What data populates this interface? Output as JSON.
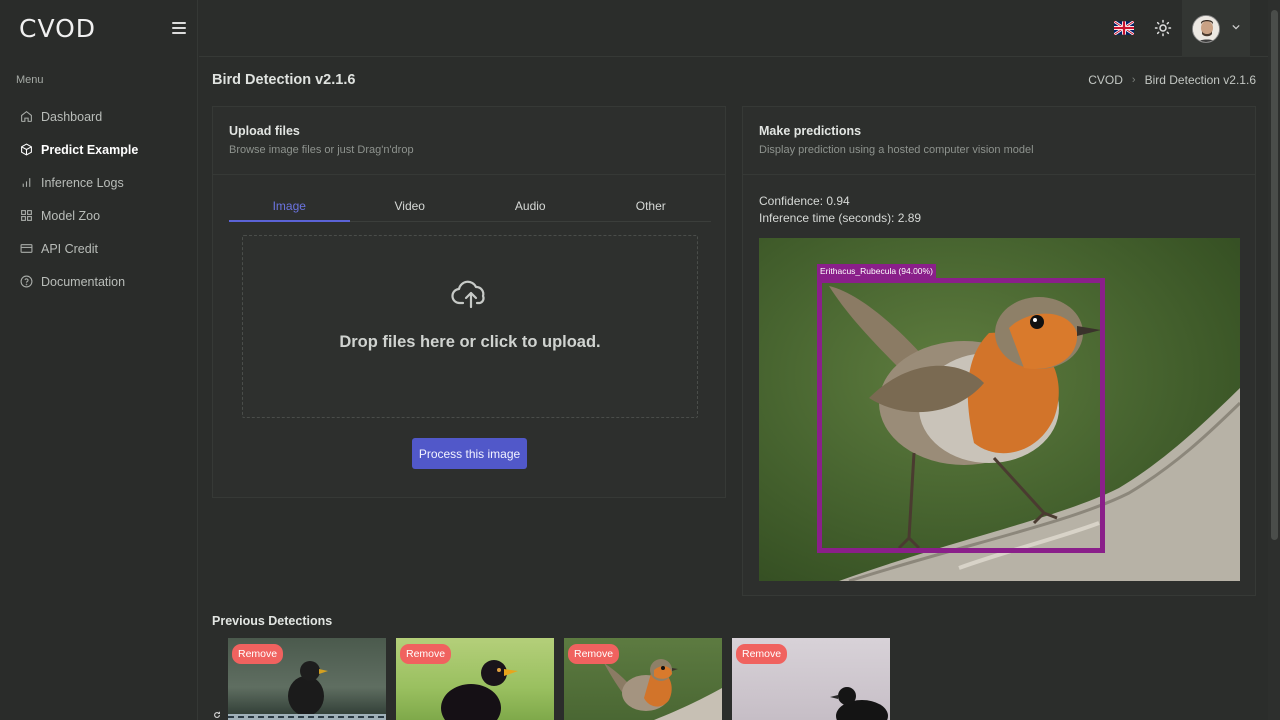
{
  "app": {
    "logo": "CVOD"
  },
  "sidebar": {
    "menu_title": "Menu",
    "items": [
      {
        "label": "Dashboard",
        "icon": "home-icon",
        "active": false
      },
      {
        "label": "Predict Example",
        "icon": "cube-icon",
        "active": true
      },
      {
        "label": "Inference Logs",
        "icon": "bar-chart-icon",
        "active": false
      },
      {
        "label": "Model Zoo",
        "icon": "grid-icon",
        "active": false
      },
      {
        "label": "API Credit",
        "icon": "credit-card-icon",
        "active": false
      },
      {
        "label": "Documentation",
        "icon": "help-circle-icon",
        "active": false
      }
    ]
  },
  "topbar": {
    "language_icon": "uk-flag-icon",
    "theme_icon": "sun-icon",
    "profile_icon": "avatar",
    "dropdown_icon": "chevron-down-icon"
  },
  "page": {
    "title": "Bird Detection v2.1.6",
    "breadcrumb": [
      "CVOD",
      "Bird Detection v2.1.6"
    ]
  },
  "upload": {
    "title": "Upload files",
    "subtitle": "Browse image files or just Drag'n'drop",
    "tabs": [
      "Image",
      "Video",
      "Audio",
      "Other"
    ],
    "active_tab": "Image",
    "drop_text": "Drop files here or click to upload.",
    "process_label": "Process this image"
  },
  "prediction": {
    "title": "Make predictions",
    "subtitle": "Display prediction using a hosted computer vision model",
    "confidence_text": "Confidence: 0.94",
    "inference_text": "Inference time (seconds): 2.89",
    "detection_label": "Erithacus_Rubecula (94.00%)",
    "bbox_color": "#8a1f8a"
  },
  "previous": {
    "title": "Previous Detections",
    "remove_label": "Remove",
    "items": [
      {
        "species": "blackbird-female"
      },
      {
        "species": "blackbird-male"
      },
      {
        "species": "robin"
      },
      {
        "species": "blackbird-silhouette"
      }
    ]
  },
  "colors": {
    "accent": "#5158c9",
    "remove": "#f0625f",
    "background": "#2b2d2b"
  }
}
